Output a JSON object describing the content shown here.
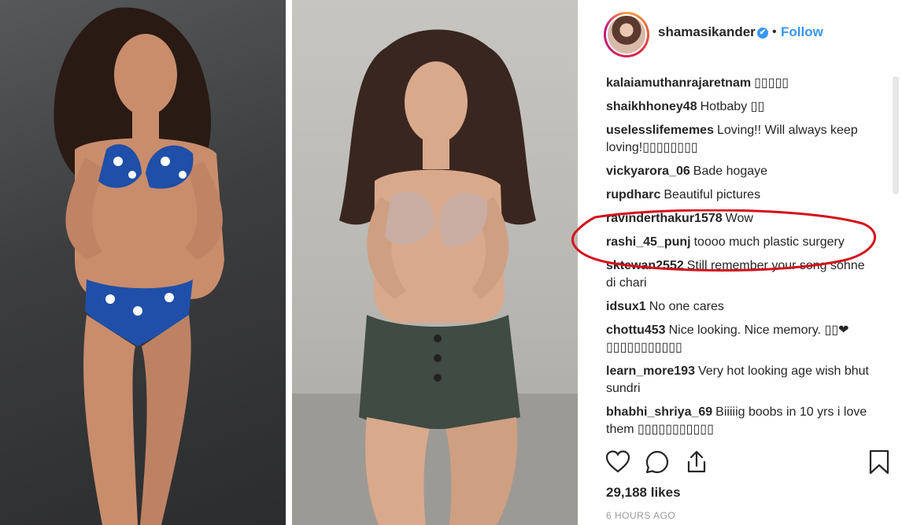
{
  "post": {
    "username": "shamasikander",
    "verified_mark": "✔",
    "separator": "•",
    "follow_label": "Follow",
    "likes": "29,188 likes",
    "timestamp": "6 HOURS AGO"
  },
  "comments": [
    {
      "author": "kalaiamuthanrajaretnam",
      "text": "▯▯▯▯▯"
    },
    {
      "author": "shaikhhoney48",
      "text": "Hotbaby ▯▯"
    },
    {
      "author": "uselesslifememes",
      "text": "Loving!! Will always keep loving!▯▯▯▯▯▯▯▯"
    },
    {
      "author": "vickyarora_06",
      "text": "Bade hogaye"
    },
    {
      "author": "rupdharc",
      "text": "Beautiful pictures"
    },
    {
      "author": "ravinderthakur1578",
      "text": "Wow"
    },
    {
      "author": "rashi_45_punj",
      "text": "toooo much plastic surgery"
    },
    {
      "author": "sktewan2552",
      "text": "Still remember your song sohne di chari"
    },
    {
      "author": "idsux1",
      "text": "No one cares"
    },
    {
      "author": "chottu453",
      "text": "Nice looking. Nice memory. ▯▯❤ ▯▯▯▯▯▯▯▯▯▯▯"
    },
    {
      "author": "learn_more193",
      "text": "Very hot looking age wish bhut sundri"
    },
    {
      "author": "bhabhi_shriya_69",
      "text": "Biiiiig boobs in 10 yrs i love them ▯▯▯▯▯▯▯▯▯▯▯"
    }
  ],
  "icons": {
    "like": "heart-icon",
    "comment": "comment-bubble-icon",
    "share": "share-upload-icon",
    "save": "bookmark-icon"
  },
  "colors": {
    "link_blue": "#3897f0",
    "highlight_red": "#d4101c",
    "muted_text": "#999999"
  }
}
